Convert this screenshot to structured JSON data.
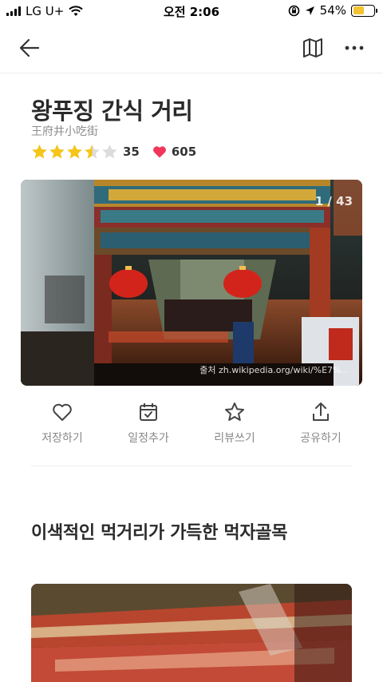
{
  "status_bar": {
    "carrier": "LG U+",
    "time": "오전 2:06",
    "battery_percent": "54%",
    "battery_level": 0.54
  },
  "nav": {
    "back_icon": "arrow-left-icon",
    "map_icon": "map-icon",
    "more_icon": "more-horizontal-icon"
  },
  "place": {
    "title": "왕푸징 간식 거리",
    "subtitle": "王府井小吃街",
    "rating": 3.5,
    "rating_count": "35",
    "like_count": "605"
  },
  "hero": {
    "counter": "1 / 43",
    "caption": "출처 zh.wikipedia.org/wiki/%E7%..."
  },
  "actions": [
    {
      "label": "저장하기",
      "icon": "heart-outline-icon"
    },
    {
      "label": "일정추가",
      "icon": "calendar-check-icon"
    },
    {
      "label": "리뷰쓰기",
      "icon": "star-outline-icon"
    },
    {
      "label": "공유하기",
      "icon": "share-icon"
    }
  ],
  "section": {
    "title": "이색적인 먹거리가 가득한 먹자골목"
  },
  "colors": {
    "star": "#f5c518",
    "heart": "#f0365a",
    "battery": "#f3c330"
  }
}
